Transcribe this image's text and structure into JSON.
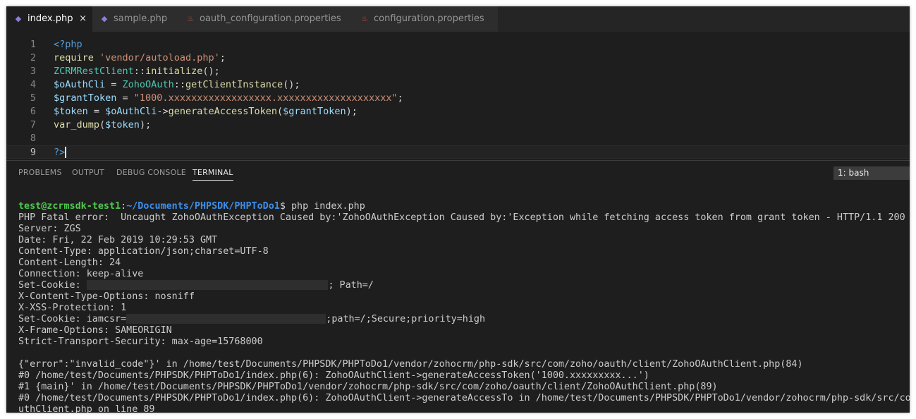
{
  "tabs": [
    {
      "label": "index.php",
      "icon": "php-file-icon",
      "active": true
    },
    {
      "label": "sample.php",
      "icon": "php-file-icon",
      "active": false
    },
    {
      "label": "oauth_configuration.properties",
      "icon": "java-file-icon",
      "active": false
    },
    {
      "label": "configuration.properties",
      "icon": "java-file-icon",
      "active": false
    }
  ],
  "tab_close_glyph": "×",
  "editor": {
    "line_numbers": [
      "1",
      "2",
      "3",
      "4",
      "5",
      "6",
      "7",
      "8",
      "9"
    ],
    "current_line": 9,
    "lines": [
      [
        [
          "kw",
          "<?php"
        ]
      ],
      [
        [
          "fn",
          "require"
        ],
        [
          "txt",
          " "
        ],
        [
          "str",
          "'vendor/autoload.php'"
        ],
        [
          "txt",
          ";"
        ]
      ],
      [
        [
          "cls",
          "ZCRMRestClient"
        ],
        [
          "txt",
          "::"
        ],
        [
          "fn",
          "initialize"
        ],
        [
          "txt",
          "();"
        ]
      ],
      [
        [
          "var",
          "$oAuthCli"
        ],
        [
          "txt",
          " = "
        ],
        [
          "cls",
          "ZohoOAuth"
        ],
        [
          "txt",
          "::"
        ],
        [
          "fn",
          "getClientInstance"
        ],
        [
          "txt",
          "();"
        ]
      ],
      [
        [
          "var",
          "$grantToken"
        ],
        [
          "txt",
          " = "
        ],
        [
          "str",
          "\"1000.xxxxxxxxxxxxxxxxxx.xxxxxxxxxxxxxxxxxxxx\""
        ],
        [
          "txt",
          ";"
        ]
      ],
      [
        [
          "var",
          "$token"
        ],
        [
          "txt",
          " = "
        ],
        [
          "var",
          "$oAuthCli"
        ],
        [
          "txt",
          "->"
        ],
        [
          "fn",
          "generateAccessToken"
        ],
        [
          "txt",
          "("
        ],
        [
          "var",
          "$grantToken"
        ],
        [
          "txt",
          ");"
        ]
      ],
      [
        [
          "fn",
          "var_dump"
        ],
        [
          "txt",
          "("
        ],
        [
          "var",
          "$token"
        ],
        [
          "txt",
          ");"
        ]
      ],
      [],
      [
        [
          "kw",
          "?>"
        ]
      ]
    ]
  },
  "panel": {
    "tabs": [
      "PROBLEMS",
      "OUTPUT",
      "DEBUG CONSOLE",
      "TERMINAL"
    ],
    "active_tab": "TERMINAL",
    "shell_selector": "1: bash"
  },
  "terminal": {
    "prompt_user": "test@zcrmsdk-test1",
    "prompt_path": "~/Documents/PHPSDK/PHPToDo1",
    "prompt_symbol": "$",
    "command": "php index.php",
    "lines": [
      "PHP Fatal error:  Uncaught ZohoOAuthException Caused by:'ZohoOAuthException Caused by:'Exception while fetching access token from grant token - HTTP/1.1 200",
      "Server: ZGS",
      "Date: Fri, 22 Feb 2019 10:29:53 GMT",
      "Content-Type: application/json;charset=UTF-8",
      "Content-Length: 24",
      "Connection: keep-alive",
      [
        "Set-Cookie: ",
        46,
        "; Path=/"
      ],
      "X-Content-Type-Options: nosniff",
      "X-XSS-Protection: 1",
      [
        "Set-Cookie: iamcsr=",
        38,
        ";path=/;Secure;priority=high"
      ],
      "X-Frame-Options: SAMEORIGIN",
      "Strict-Transport-Security: max-age=15768000",
      "",
      "{\"error\":\"invalid_code\"}' in /home/test/Documents/PHPSDK/PHPToDo1/vendor/zohocrm/php-sdk/src/com/zoho/oauth/client/ZohoOAuthClient.php(84)",
      "#0 /home/test/Documents/PHPSDK/PHPToDo1/index.php(6): ZohoOAuthClient->generateAccessToken('1000.xxxxxxxxx...')",
      "#1 {main}' in /home/test/Documents/PHPSDK/PHPToDo1/vendor/zohocrm/php-sdk/src/com/zoho/oauth/client/ZohoOAuthClient.php(89)",
      "#0 /home/test/Documents/PHPSDK/PHPToDo1/index.php(6): ZohoOAuthClient->generateAccessTo in /home/test/Documents/PHPSDK/PHPToDo1/vendor/zohocrm/php-sdk/src/com",
      "uthClient.php on line 89"
    ]
  },
  "colors": {
    "editor_bg": "#1e1e1e",
    "tab_bar_bg": "#252526",
    "prompt_user": "#4ec94e",
    "prompt_path": "#3b8eea",
    "terminal_text": "#cccccc"
  }
}
